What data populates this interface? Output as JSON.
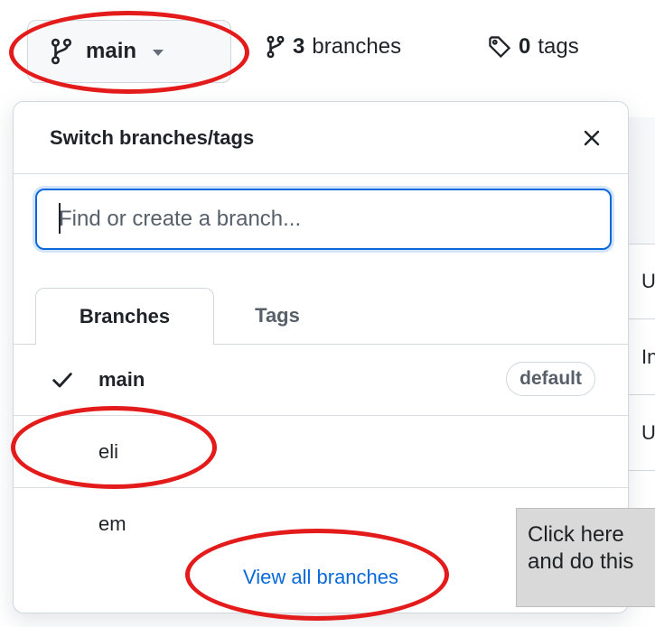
{
  "header": {
    "branch_button_label": "main",
    "branches_count": "3",
    "branches_word": "branches",
    "tags_count": "0",
    "tags_word": "tags"
  },
  "dropdown": {
    "title": "Switch branches/tags",
    "search_placeholder": "Find or create a branch...",
    "tabs": [
      {
        "label": "Branches",
        "active": true
      },
      {
        "label": "Tags",
        "active": false
      }
    ],
    "branches": [
      {
        "name": "main",
        "selected": true,
        "badge": "default"
      },
      {
        "name": "eli",
        "selected": false,
        "badge": ""
      },
      {
        "name": "em",
        "selected": false,
        "badge": ""
      }
    ],
    "view_all_label": "View all branches"
  },
  "background_rows": [
    {
      "text": "U"
    },
    {
      "text": "In"
    },
    {
      "text": "U"
    }
  ],
  "callout": {
    "line1": "Click here",
    "line2": "and do this"
  },
  "colors": {
    "annotation": "#e31b1b",
    "link": "#0969da",
    "callout_bg": "#d9d9d9"
  }
}
